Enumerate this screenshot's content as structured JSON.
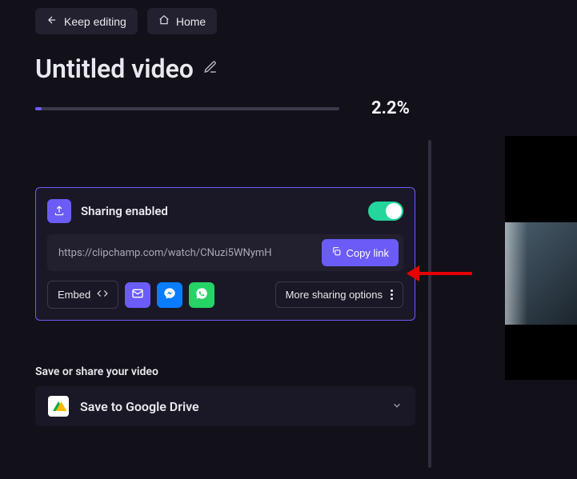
{
  "topbar": {
    "keep_editing": "Keep editing",
    "home": "Home"
  },
  "title": "Untitled video",
  "progress": {
    "percent": 2.2,
    "label": "2.2%"
  },
  "sharing": {
    "heading": "Sharing enabled",
    "enabled": true,
    "link": "https://clipchamp.com/watch/CNuzi5WNymH",
    "copy_label": "Copy link",
    "embed_label": "Embed",
    "more_label": "More sharing options"
  },
  "save_section": {
    "heading": "Save or share your video",
    "google_drive_label": "Save to Google Drive"
  }
}
